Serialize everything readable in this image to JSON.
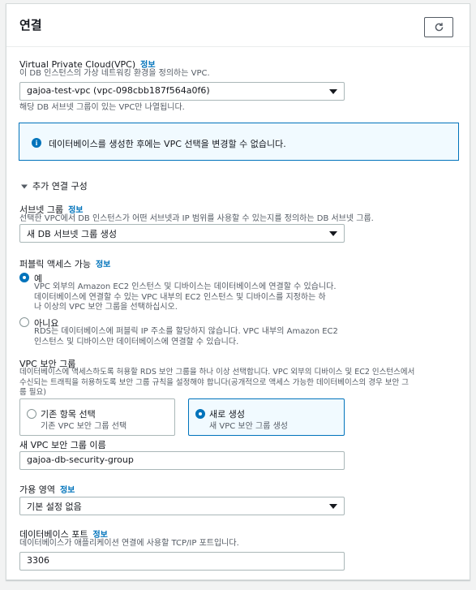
{
  "section": {
    "title": "연결"
  },
  "info_link": "정보",
  "vpc": {
    "label": "Virtual Private Cloud(VPC)",
    "description": "이 DB 인스턴스의 가상 네트워킹 환경을 정의하는 VPC.",
    "value": "gajoa-test-vpc (vpc-098cbb187f564a0f6)",
    "hint": "해당 DB 서브넷 그룹이 있는 VPC만 나열됩니다."
  },
  "alert": {
    "icon": "info-circle-icon",
    "text": "데이터베이스를 생성한 후에는 VPC 선택을 변경할 수 없습니다."
  },
  "additional": {
    "title": "추가 연결 구성",
    "expanded": true
  },
  "subnet": {
    "label": "서브넷 그룹",
    "description": "선택한 VPC에서 DB 인스턴스가 어떤 서브넷과 IP 범위를 사용할 수 있는지를 정의하는 DB 서브넷 그룹.",
    "value": "새 DB 서브넷 그룹 생성"
  },
  "public_access": {
    "label": "퍼블릭 액세스 가능",
    "options": [
      {
        "title": "예",
        "desc_lines": [
          "VPC 외부의 Amazon EC2 인스턴스 및 디바이스는 데이터베이스에 연결할 수 있습니다.",
          "데이터베이스에 연결할 수 있는 VPC 내부의 EC2 인스턴스 및 디바이스를 지정하는 하",
          "나 이상의 VPC 보안 그룹을 선택하십시오."
        ],
        "selected": true
      },
      {
        "title": "아니요",
        "desc_lines": [
          "RDS는 데이터베이스에 퍼블릭 IP 주소를 할당하지 않습니다. VPC 내부의 Amazon EC2",
          "인스턴스 및 디바이스만 데이터베이스에 연결할 수 있습니다."
        ],
        "selected": false
      }
    ]
  },
  "security_group": {
    "label": "VPC 보안 그룹",
    "desc_lines": [
      "데이터베이스에 액세스하도록 허용할 RDS 보안 그룹을 하나 이상 선택합니다. VPC 외부의 디바이스 및 EC2 인스턴스에서",
      "수신되는 트래픽을 허용하도록 보안 그룹 규칙을 설정해야 합니다(공개적으로 액세스 가능한 데이터베이스의 경우 보안 그",
      "룹 필요)"
    ],
    "options": [
      {
        "title": "기존 항목 선택",
        "desc": "기존 VPC 보안 그룹 선택",
        "selected": false
      },
      {
        "title": "새로 생성",
        "desc": "새 VPC 보안 그룹 생성",
        "selected": true
      }
    ]
  },
  "new_sg": {
    "label": "새 VPC 보안 그룹 이름",
    "value": "gajoa-db-security-group"
  },
  "az": {
    "label": "가용 영역",
    "value": "기본 설정 없음"
  },
  "port": {
    "label": "데이터베이스 포트",
    "description": "데이터베이스가 애플리케이션 연결에 사용할 TCP/IP 포트입니다.",
    "value": "3306"
  },
  "icons": {
    "refresh": "refresh-icon",
    "expand": "caret-down-icon",
    "dropdown": "chevron-down-icon"
  }
}
